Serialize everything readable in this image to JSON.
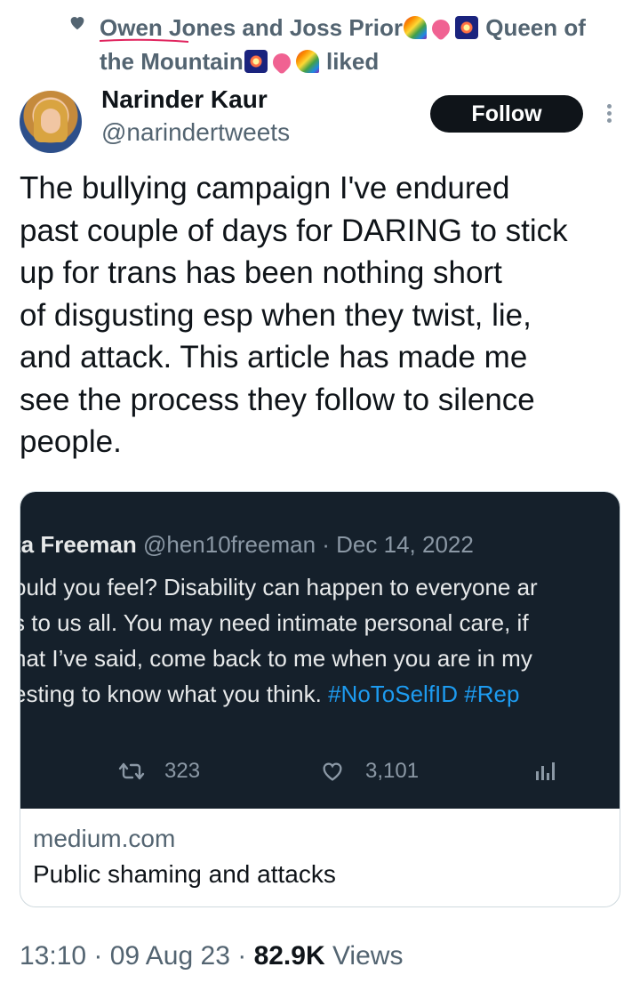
{
  "social_context": {
    "icon": "heart-icon",
    "name_link": "Owen Jones",
    "text_part1": " and Joss Prior",
    "text_part2": " Queen of the Mountain",
    "text_part3": " liked",
    "underline_color": "#e0245e"
  },
  "author": {
    "name": "Narinder Kaur",
    "handle": "@narindertweets",
    "follow_label": "Follow"
  },
  "tweet": {
    "lines": [
      "The bullying campaign I've endured",
      "past couple of days for DARING to stick",
      "up for trans has been nothing short",
      "of disgusting esp when they twist, lie,",
      "and attack. This article has made me",
      "see the process they follow to silence",
      "people."
    ]
  },
  "card": {
    "media": {
      "author_name": "ta Freeman",
      "author_handle": "@hen10freeman",
      "separator": " · ",
      "date": "Dec 14, 2022",
      "lines": [
        "ould you feel? Disability can happen to everyone ar",
        "s to us all. You may need intimate personal care, if",
        "hat I’ve said, come back to me when you are in my"
      ],
      "last_line_text": "esting to know what you think. ",
      "hashtags": "#NoToSelfID #Rep",
      "retweets": "323",
      "likes": "3,101"
    },
    "domain": "medium.com",
    "title": "Public shaming and attacks"
  },
  "meta": {
    "time": "13:10",
    "date": "09 Aug 23",
    "separator": " · ",
    "views_count": "82.9K",
    "views_label": " Views"
  },
  "colors": {
    "text_primary": "#0f1419",
    "text_secondary": "#536471",
    "follow_bg": "#0f1419",
    "link_blue": "#1d9bf0",
    "media_bg": "#15202b"
  }
}
